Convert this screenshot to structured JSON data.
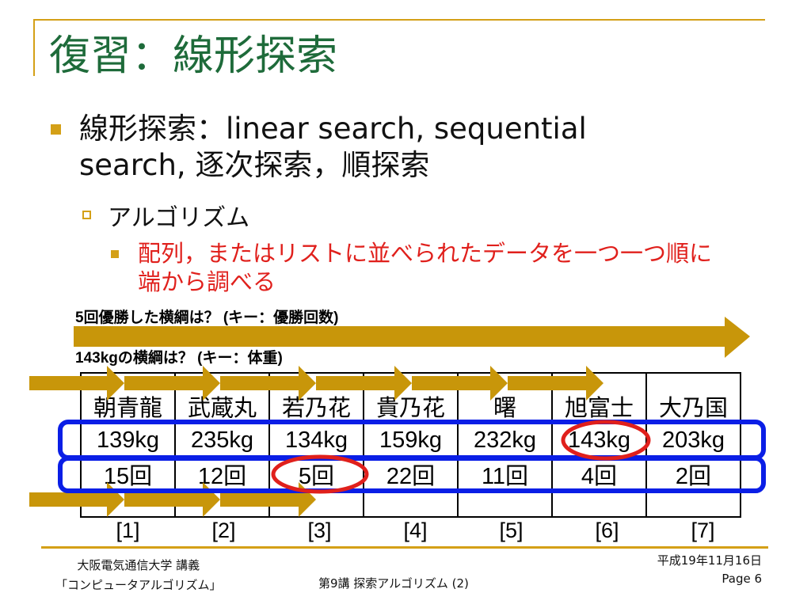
{
  "title": "復習：線形探索",
  "bullet1": {
    "line1": "線形探索：linear search, sequential",
    "line2": "search, 逐次探索，順探索"
  },
  "bullet2": "アルゴリズム",
  "bullet3": {
    "line1": "配列，またはリストに並べられたデータを一つ一つ順に",
    "line2": "端から調べる"
  },
  "question1": "5回優勝した横綱は？ (キー：優勝回数)",
  "question2": "143kgの横綱は？ (キー：体重)",
  "table": {
    "names": [
      "朝青龍",
      "武蔵丸",
      "若乃花",
      "貴乃花",
      "曙",
      "旭富士",
      "大乃国"
    ],
    "weights": [
      "139kg",
      "235kg",
      "134kg",
      "159kg",
      "232kg",
      "143kg",
      "203kg"
    ],
    "wins": [
      "15回",
      "12回",
      "5回",
      "22回",
      "11回",
      "4回",
      "2回"
    ],
    "indices": [
      "[1]",
      "[2]",
      "[3]",
      "[4]",
      "[5]",
      "[6]",
      "[7]"
    ]
  },
  "footer": {
    "left1": "大阪電気通信大学 講義",
    "left2": "「コンピュータアルゴリズム」",
    "center": "第9講 探索アルゴリズム (2)",
    "date": "平成19年11月16日",
    "page": "Page 6"
  },
  "colors": {
    "accent": "#d4a017",
    "arrow": "#c8960a",
    "title": "#1e6b3a",
    "highlight": "#e0201c",
    "frame": "#0a1ee6"
  }
}
